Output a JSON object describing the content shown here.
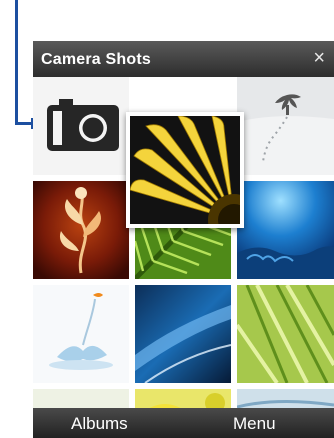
{
  "window": {
    "title": "Camera Shots",
    "close_glyph": "×"
  },
  "softkeys": {
    "left": "Albums",
    "right": "Menu"
  },
  "thumbnails": [
    {
      "name": "camera-mode",
      "icon": "camera-icon"
    },
    {
      "name": "yellow-gerbera",
      "selected": true
    },
    {
      "name": "snow-tree"
    },
    {
      "name": "floral-art"
    },
    {
      "name": "green-fern"
    },
    {
      "name": "underwater-reef"
    },
    {
      "name": "water-splash"
    },
    {
      "name": "blue-leaf"
    },
    {
      "name": "green-grass"
    }
  ],
  "colors": {
    "callout": "#1c4fa0",
    "titlebar": "#3a3a3a",
    "softkey_bar": "#2a2a2a"
  }
}
